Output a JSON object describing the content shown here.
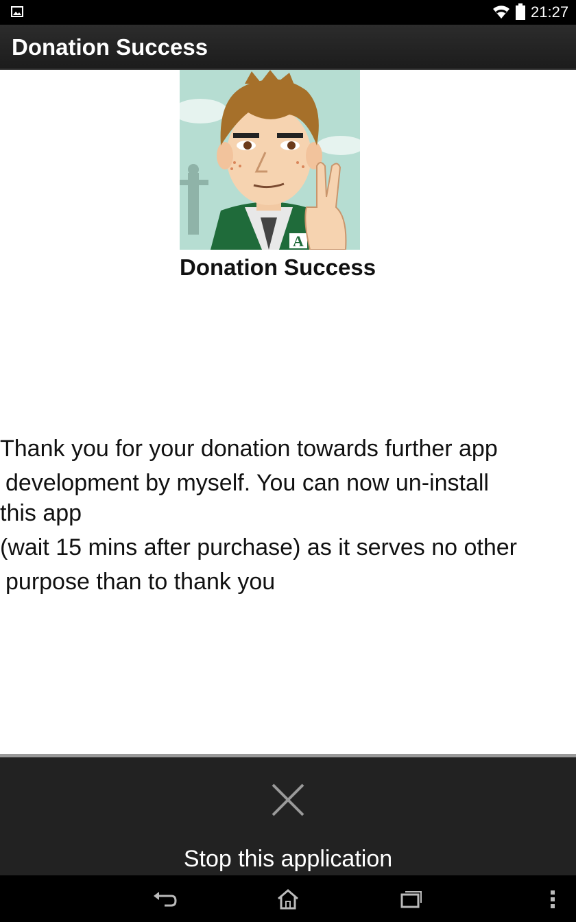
{
  "status_bar": {
    "time": "21:27",
    "icons": [
      "gallery-icon",
      "wifi-icon",
      "battery-icon"
    ]
  },
  "action_bar": {
    "title": "Donation Success"
  },
  "content": {
    "title": "Donation Success",
    "message_lines": [
      "Thank you for your donation towards further app",
      "development by myself. You can now un-install",
      "this app",
      "(wait 15 mins after purchase) as it serves no other",
      "purpose than to thank you"
    ]
  },
  "stop_panel": {
    "icon": "close-icon",
    "label": "Stop this application"
  },
  "nav_bar": {
    "icons": [
      "back-icon",
      "home-icon",
      "recents-icon",
      "overflow-menu-icon"
    ]
  },
  "colors": {
    "status_bar_bg": "#000000",
    "action_bar_bg": "#222222",
    "content_bg": "#ffffff",
    "panel_bg": "#222222",
    "text_dark": "#111111",
    "text_light": "#ffffff"
  }
}
